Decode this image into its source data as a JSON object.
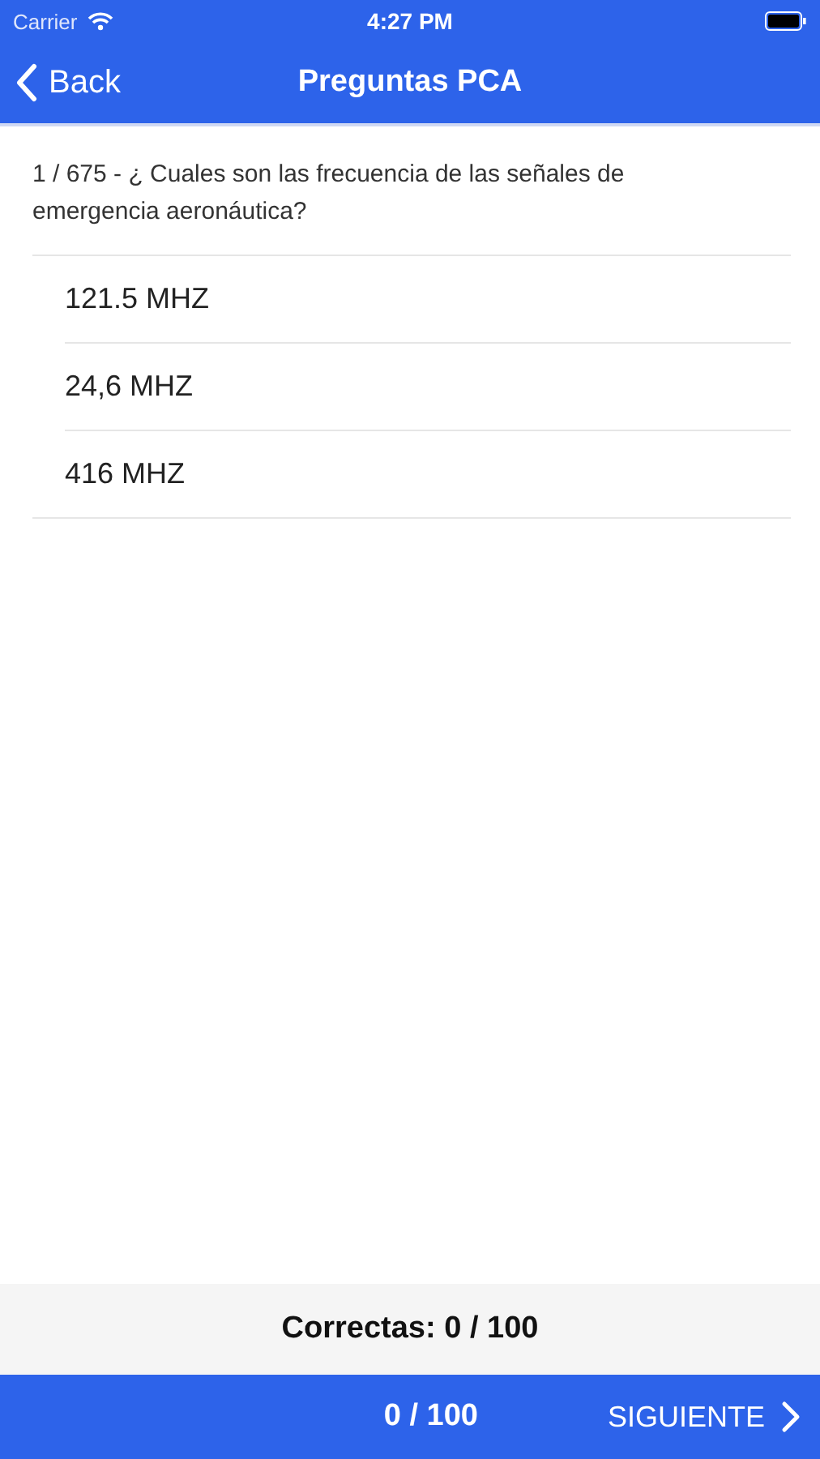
{
  "status_bar": {
    "carrier": "Carrier",
    "time": "4:27 PM"
  },
  "nav_bar": {
    "back": "Back",
    "title": "Preguntas PCA"
  },
  "question": "1 / 675 - ¿ Cuales son las frecuencia de las señales de emergencia aeronáutica?",
  "answers": [
    {
      "text": "121.5 MHZ"
    },
    {
      "text": "24,6 MHZ"
    },
    {
      "text": "416 MHZ"
    }
  ],
  "score": "Correctas: 0 / 100",
  "footer": {
    "progress": "0 / 100",
    "next": "SIGUIENTE"
  }
}
